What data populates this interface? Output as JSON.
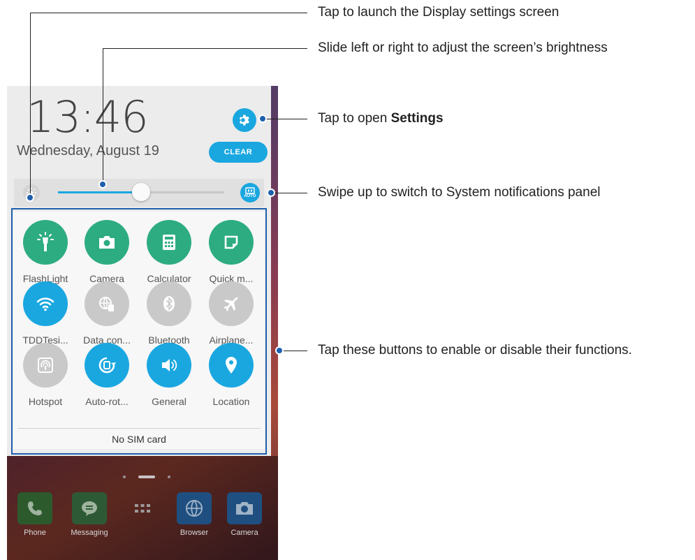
{
  "panel": {
    "time": "13:46",
    "date": "Wednesday, August 19",
    "clear_label": "CLEAR",
    "brightness_fraction": 0.5,
    "auto_label": "AUTO",
    "accent": "#1aa7e0",
    "green": "#2dac82"
  },
  "tiles": [
    {
      "label": "FlashLight",
      "icon": "flashlight-icon",
      "state": "green"
    },
    {
      "label": "Camera",
      "icon": "camera-icon",
      "state": "green"
    },
    {
      "label": "Calculator",
      "icon": "calculator-icon",
      "state": "green"
    },
    {
      "label": "Quick m...",
      "icon": "quick-memo-icon",
      "state": "green"
    },
    {
      "label": "TDDTesi...",
      "icon": "wifi-icon",
      "state": "blue"
    },
    {
      "label": "Data con...",
      "icon": "data-connection-icon",
      "state": "grey"
    },
    {
      "label": "Bluetooth",
      "icon": "bluetooth-icon",
      "state": "grey"
    },
    {
      "label": "Airplane...",
      "icon": "airplane-icon",
      "state": "grey"
    },
    {
      "label": "Hotspot",
      "icon": "hotspot-icon",
      "state": "grey"
    },
    {
      "label": "Auto-rot...",
      "icon": "auto-rotate-icon",
      "state": "blue"
    },
    {
      "label": "General",
      "icon": "volume-icon",
      "state": "blue"
    },
    {
      "label": "Location",
      "icon": "location-icon",
      "state": "blue"
    }
  ],
  "sim_status": "No SIM card",
  "dock": [
    {
      "label": "Phone",
      "icon": "phone-icon"
    },
    {
      "label": "Messaging",
      "icon": "messaging-icon"
    },
    {
      "label": "",
      "icon": "app-drawer-icon"
    },
    {
      "label": "Browser",
      "icon": "browser-icon"
    },
    {
      "label": "Camera",
      "icon": "camera-app-icon"
    }
  ],
  "callouts": {
    "display_settings": "Tap to launch the Display settings screen",
    "brightness": "Slide left or right to adjust the screen’s brightness",
    "settings_prefix": "Tap to open ",
    "settings_bold": "Settings",
    "system_panel": "Swipe up to switch to System notifications panel",
    "toggles": "Tap these buttons to enable or disable their functions."
  },
  "annotation_color": "#1f5fae"
}
